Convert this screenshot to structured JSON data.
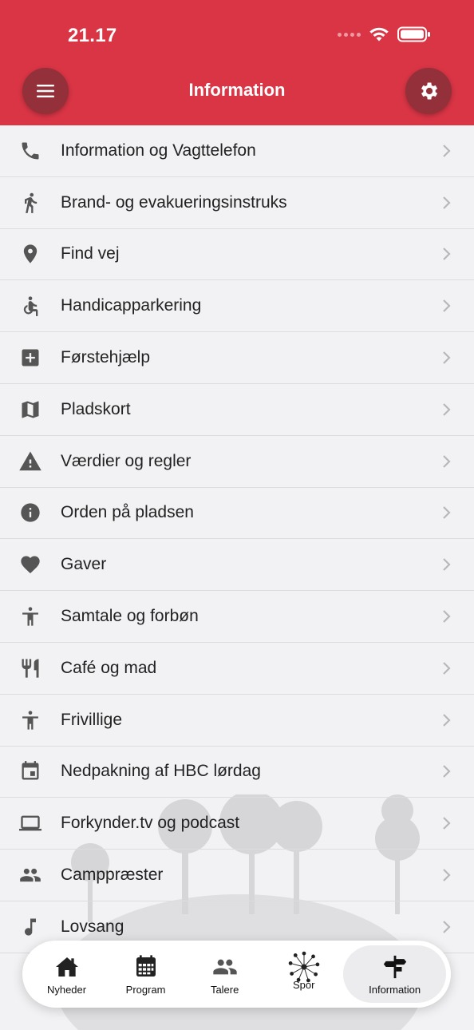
{
  "status": {
    "time": "21.17"
  },
  "header": {
    "title": "Information"
  },
  "items": [
    {
      "label": "Information og Vagttelefon",
      "icon": "phone-icon"
    },
    {
      "label": "Brand- og evakueringsinstruks",
      "icon": "running-person-icon"
    },
    {
      "label": "Find vej",
      "icon": "location-pin-icon"
    },
    {
      "label": "Handicapparkering",
      "icon": "wheelchair-icon"
    },
    {
      "label": "Førstehjælp",
      "icon": "first-aid-icon"
    },
    {
      "label": "Pladskort",
      "icon": "map-icon"
    },
    {
      "label": "Værdier og regler",
      "icon": "warning-icon"
    },
    {
      "label": "Orden på pladsen",
      "icon": "info-icon"
    },
    {
      "label": "Gaver",
      "icon": "heart-icon"
    },
    {
      "label": "Samtale og forbøn",
      "icon": "person-icon"
    },
    {
      "label": "Café og mad",
      "icon": "fork-knife-icon"
    },
    {
      "label": "Frivillige",
      "icon": "person-icon"
    },
    {
      "label": "Nedpakning af HBC lørdag",
      "icon": "calendar-icon"
    },
    {
      "label": "Forkynder.tv og podcast",
      "icon": "laptop-icon"
    },
    {
      "label": "Camppræster",
      "icon": "people-icon"
    },
    {
      "label": "Lovsang",
      "icon": "music-note-icon"
    }
  ],
  "tabs": [
    {
      "label": "Nyheder",
      "icon": "house-icon"
    },
    {
      "label": "Program",
      "icon": "calendar-grid-icon"
    },
    {
      "label": "Talere",
      "icon": "people-icon"
    },
    {
      "label": "Spor",
      "icon": "dandelion-icon"
    },
    {
      "label": "Information",
      "icon": "signpost-icon",
      "active": true
    }
  ],
  "colors": {
    "accent": "#d93545",
    "accent_dark": "#93303a",
    "icon": "#555555"
  }
}
